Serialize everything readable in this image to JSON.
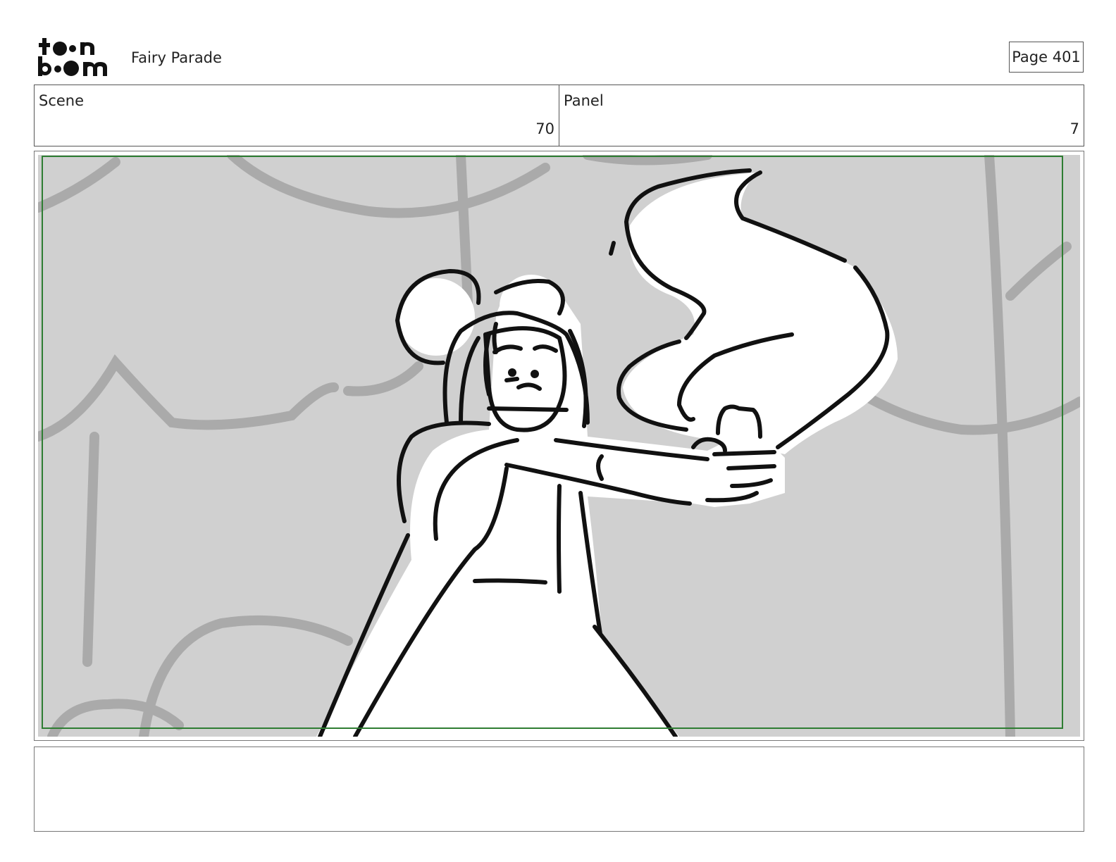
{
  "header": {
    "logo_top": "t  n",
    "logo_bottom": "b  m",
    "project_title": "Fairy Parade",
    "page_label": "Page 401"
  },
  "info": {
    "scene_label": "Scene",
    "scene_value": "70",
    "panel_label": "Panel",
    "panel_value": "7"
  },
  "notes": {
    "text": ""
  }
}
